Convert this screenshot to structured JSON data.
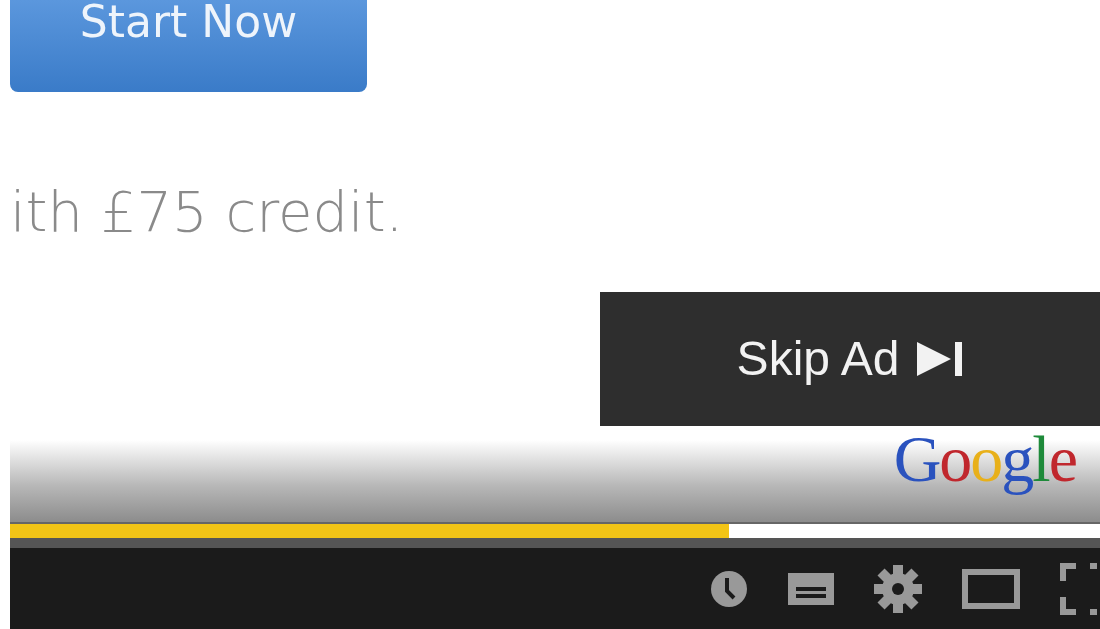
{
  "ad_page": {
    "cta_button": "Start Now",
    "offer_text": "ith £75 credit."
  },
  "skip_button": {
    "label": "Skip Ad"
  },
  "ad_branding": {
    "logo_text": "Google"
  },
  "progress": {
    "level": 0.66
  }
}
